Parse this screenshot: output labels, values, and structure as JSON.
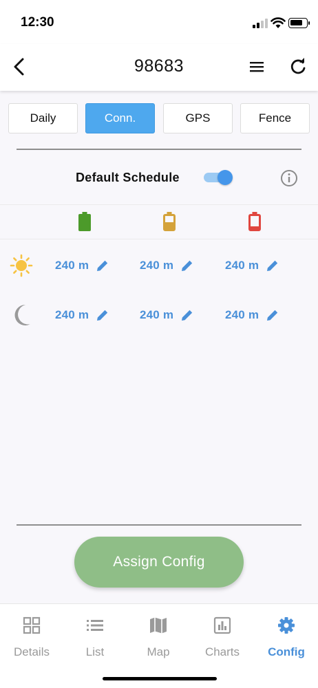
{
  "status_bar": {
    "time": "12:30"
  },
  "header": {
    "title": "98683"
  },
  "tabs": [
    {
      "label": "Daily",
      "active": false
    },
    {
      "label": "Conn.",
      "active": true
    },
    {
      "label": "GPS",
      "active": false
    },
    {
      "label": "Fence",
      "active": false
    }
  ],
  "schedule": {
    "label": "Default Schedule",
    "enabled": true
  },
  "battery_columns": [
    {
      "icon": "battery-full-icon",
      "color": "#4c9a2a"
    },
    {
      "icon": "battery-half-icon",
      "color": "#d4a23a"
    },
    {
      "icon": "battery-low-icon",
      "color": "#e0463f"
    }
  ],
  "rows": [
    {
      "icon": "sun-icon",
      "values": [
        "240 m",
        "240 m",
        "240 m"
      ]
    },
    {
      "icon": "moon-icon",
      "values": [
        "240 m",
        "240 m",
        "240 m"
      ]
    }
  ],
  "assign_button": {
    "label": "Assign Config"
  },
  "bottom_nav": [
    {
      "label": "Details",
      "icon": "grid-icon",
      "active": false
    },
    {
      "label": "List",
      "icon": "list-icon",
      "active": false
    },
    {
      "label": "Map",
      "icon": "map-icon",
      "active": false
    },
    {
      "label": "Charts",
      "icon": "bar-chart-icon",
      "active": false
    },
    {
      "label": "Config",
      "icon": "gear-icon",
      "active": true
    }
  ],
  "colors": {
    "accent": "#4a90d9",
    "tab_active": "#4ea8ee",
    "assign_button": "#8fbe87"
  }
}
